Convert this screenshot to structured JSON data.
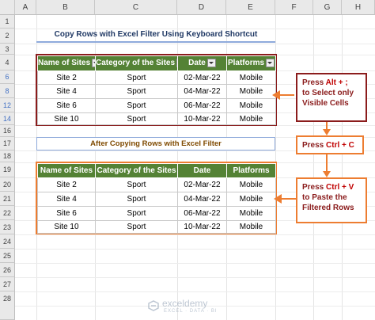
{
  "sheet": {
    "columns": [
      "A",
      "B",
      "C",
      "D",
      "E",
      "F",
      "G",
      "H"
    ],
    "rows": [
      "1",
      "2",
      "3",
      "4",
      "6",
      "8",
      "12",
      "14",
      "16",
      "17",
      "18",
      "19",
      "20",
      "21",
      "22",
      "23",
      "24",
      "25",
      "26",
      "27",
      "28"
    ],
    "highlight_rows": [
      "6",
      "8",
      "12",
      "14"
    ],
    "filtered_color": "#4472c4"
  },
  "title_top": "Copy Rows with Excel Filter Using Keyboard Shortcut",
  "title_bottom": "After Copying Rows with Excel Filter",
  "table_top": {
    "headers": [
      "Name of Sites",
      "Category of the Sites",
      "Date",
      "Platforms"
    ],
    "rows": [
      [
        "Site 2",
        "Sport",
        "02-Mar-22",
        "Mobile"
      ],
      [
        "Site 4",
        "Sport",
        "04-Mar-22",
        "Mobile"
      ],
      [
        "Site 6",
        "Sport",
        "06-Mar-22",
        "Mobile"
      ],
      [
        "Site 10",
        "Sport",
        "10-Mar-22",
        "Mobile"
      ]
    ]
  },
  "table_bottom": {
    "headers": [
      "Name of Sites",
      "Category of the Sites",
      "Date",
      "Platforms"
    ],
    "rows": [
      [
        "Site 2",
        "Sport",
        "02-Mar-22",
        "Mobile"
      ],
      [
        "Site 4",
        "Sport",
        "04-Mar-22",
        "Mobile"
      ],
      [
        "Site 6",
        "Sport",
        "06-Mar-22",
        "Mobile"
      ],
      [
        "Site 10",
        "Sport",
        "10-Mar-22",
        "Mobile"
      ]
    ]
  },
  "steps": {
    "step1": {
      "line1_a": "Press ",
      "line1_b": "Alt + ;",
      "line2": "to Select only",
      "line3": "Visible Cells"
    },
    "step2": {
      "a": "Press ",
      "b": "Ctrl + C"
    },
    "step3": {
      "line1_a": "Press ",
      "line1_b": "Ctrl + V",
      "line2": "to Paste the",
      "line3": "Filtered Rows"
    }
  },
  "watermark": {
    "name": "exceldemy",
    "tagline": "EXCEL · DATA · BI"
  },
  "colors": {
    "header_green": "#548235",
    "maroon": "#8b1c1c",
    "orange": "#ed7d31",
    "green_border": "#70ad47"
  }
}
